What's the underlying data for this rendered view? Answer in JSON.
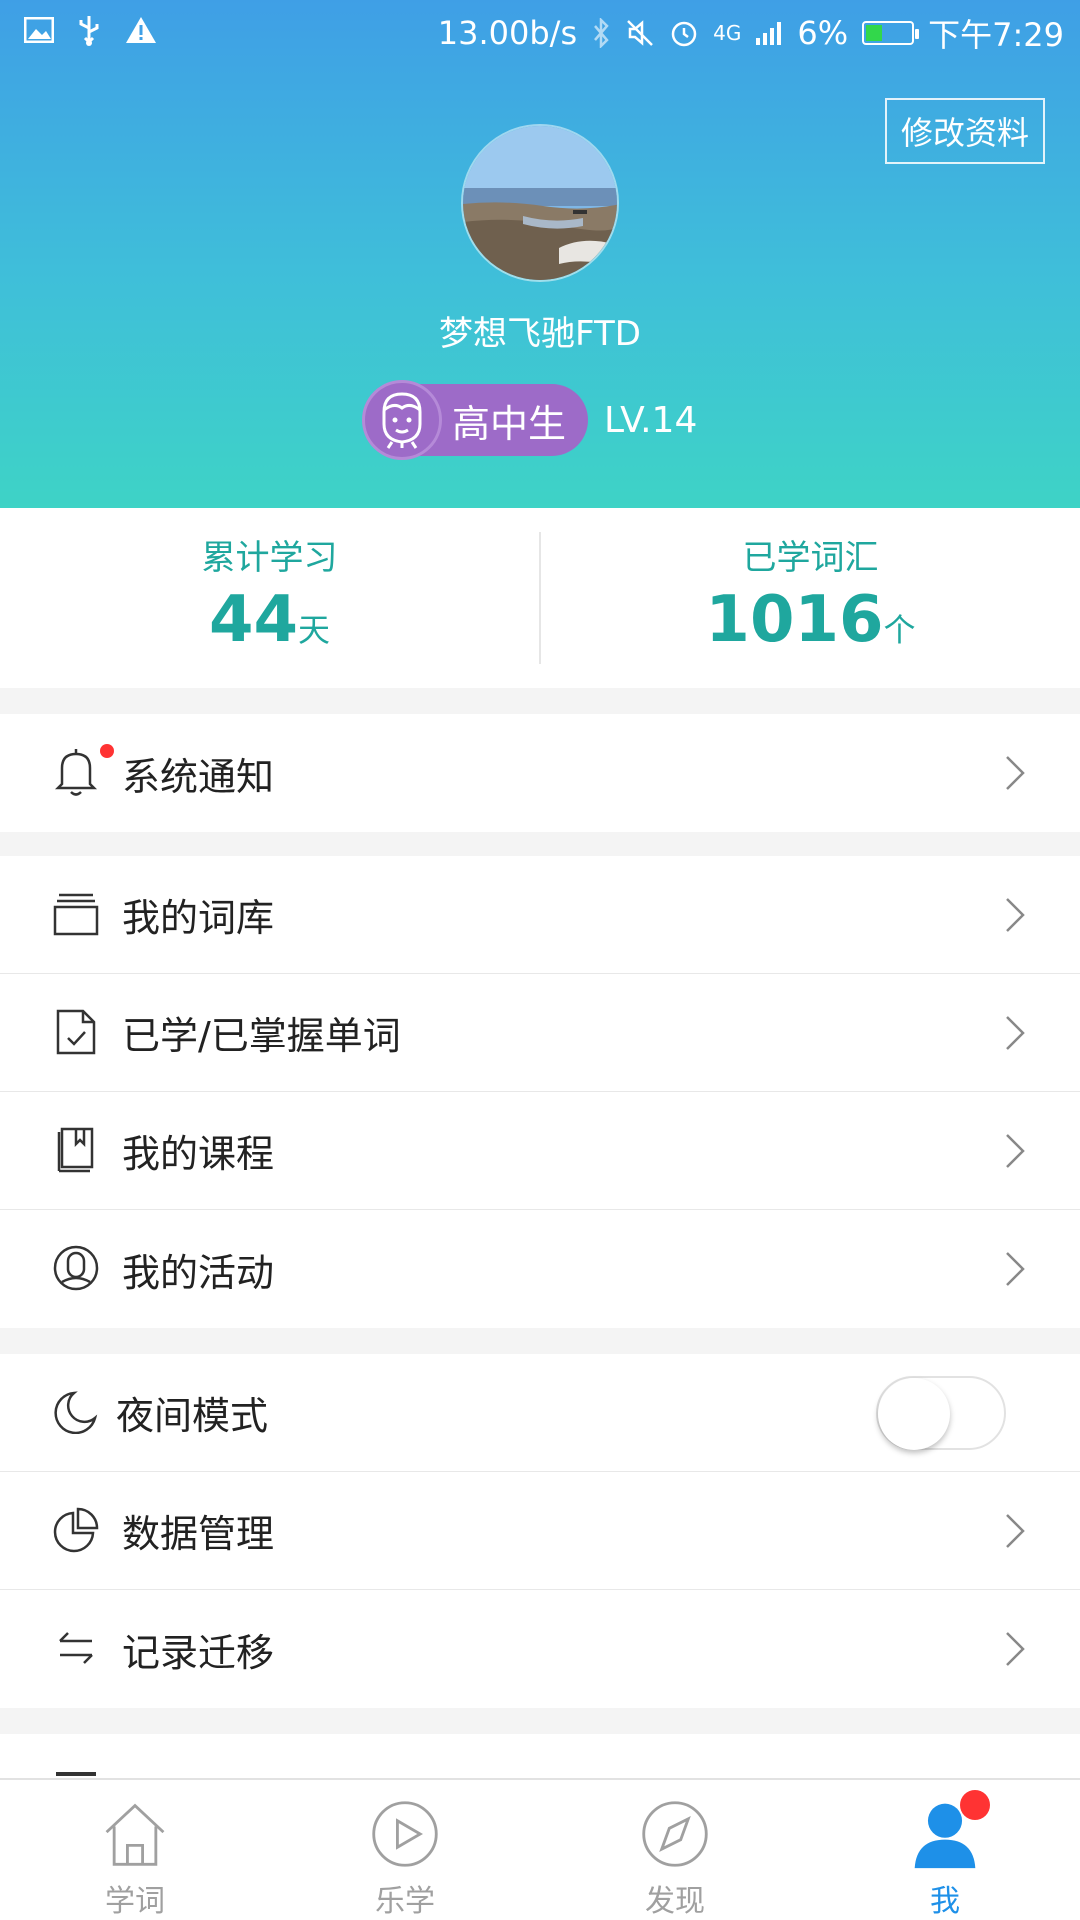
{
  "status_bar": {
    "speed": "13.00b/s",
    "network": "4G",
    "battery": "6%",
    "time": "下午7:29",
    "left_icons": [
      "image-icon",
      "usb-icon",
      "warning-icon"
    ],
    "right_icons": [
      "bluetooth-icon",
      "mute-icon",
      "alarm-icon",
      "signal-icon",
      "battery-icon"
    ]
  },
  "profile": {
    "edit_label": "修改资料",
    "username": "梦想飞驰FTD",
    "level_title": "高中生",
    "level": "LV.14"
  },
  "stats": [
    {
      "label": "累计学习",
      "value": "44",
      "unit": "天"
    },
    {
      "label": "已学词汇",
      "value": "1016",
      "unit": "个"
    }
  ],
  "menu": {
    "notification": {
      "label": "系统通知",
      "icon": "bell-icon",
      "has_dot": true
    },
    "wordbook": {
      "label": "我的词库",
      "icon": "stack-icon"
    },
    "learned": {
      "label": "已学/已掌握单词",
      "icon": "document-check-icon"
    },
    "courses": {
      "label": "我的课程",
      "icon": "book-icon"
    },
    "activities": {
      "label": "我的活动",
      "icon": "activity-icon"
    },
    "night_mode": {
      "label": "夜间模式",
      "icon": "moon-icon",
      "enabled": false
    },
    "data": {
      "label": "数据管理",
      "icon": "pie-icon"
    },
    "migrate": {
      "label": "记录迁移",
      "icon": "transfer-icon"
    }
  },
  "bottom_nav": [
    {
      "label": "学词",
      "icon": "home-icon",
      "active": false
    },
    {
      "label": "乐学",
      "icon": "play-icon",
      "active": false
    },
    {
      "label": "发现",
      "icon": "compass-icon",
      "active": false
    },
    {
      "label": "我",
      "icon": "user-icon",
      "active": true,
      "has_dot": true
    }
  ],
  "colors": {
    "header_top": "#3f9fe6",
    "header_bottom": "#3ed3c6",
    "accent_teal": "#1fa79e",
    "badge_purple": "#9d6bc8",
    "active_blue": "#1e90e8",
    "alert_red": "#ff3333"
  }
}
